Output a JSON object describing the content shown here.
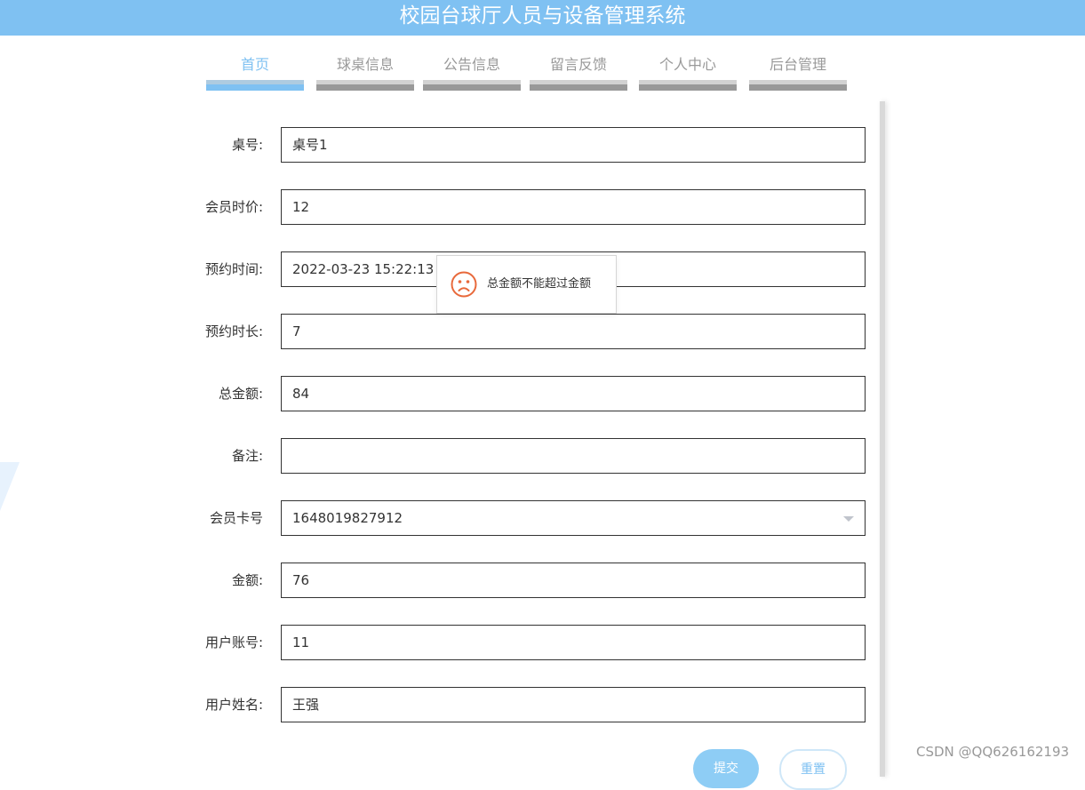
{
  "header": {
    "title": "校园台球厅人员与设备管理系统"
  },
  "nav": {
    "items": [
      {
        "label": "首页",
        "active": true
      },
      {
        "label": "球桌信息",
        "active": false
      },
      {
        "label": "公告信息",
        "active": false
      },
      {
        "label": "留言反馈",
        "active": false
      },
      {
        "label": "个人中心",
        "active": false
      },
      {
        "label": "后台管理",
        "active": false
      }
    ]
  },
  "form": {
    "rows": [
      {
        "label": "桌号:",
        "value": "桌号1"
      },
      {
        "label": "会员时价:",
        "value": "12"
      },
      {
        "label": "预约时间:",
        "value": "2022-03-23 15:22:13"
      },
      {
        "label": "预约时长:",
        "value": "7"
      },
      {
        "label": "总金额:",
        "value": "84"
      },
      {
        "label": "备注:",
        "value": ""
      },
      {
        "label": "会员卡号",
        "value": "1648019827912",
        "type": "select"
      },
      {
        "label": "金额:",
        "value": "76"
      },
      {
        "label": "用户账号:",
        "value": "11"
      },
      {
        "label": "用户姓名:",
        "value": "王强"
      }
    ],
    "submit_label": "提交",
    "reset_label": "重置"
  },
  "toast": {
    "message": "总金额不能超过金额",
    "icon": "sad-face-icon",
    "color": "#e8693b"
  },
  "watermark": "CSDN @QQ626162193",
  "colors": {
    "accent": "#7fc1f2"
  }
}
